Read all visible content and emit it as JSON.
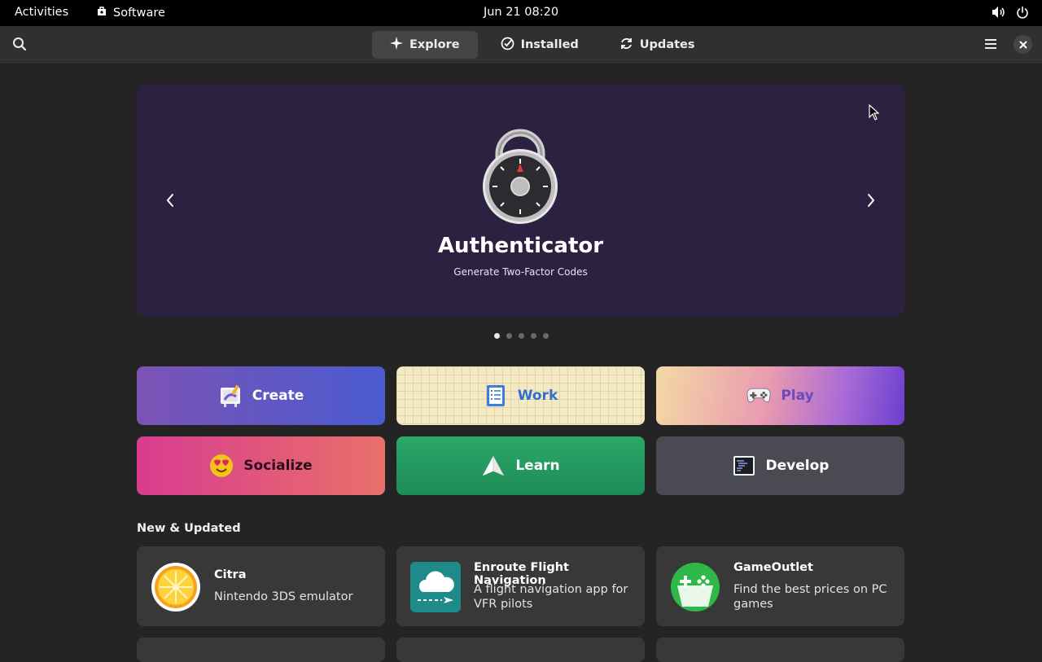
{
  "topbar": {
    "activities": "Activities",
    "app_name": "Software",
    "clock": "Jun 21  08:20",
    "icons": [
      "volume-icon",
      "power-icon"
    ]
  },
  "headerbar": {
    "tabs": [
      {
        "label": "Explore",
        "icon": "sparkle-icon",
        "active": true
      },
      {
        "label": "Installed",
        "icon": "check-circle-icon",
        "active": false
      },
      {
        "label": "Updates",
        "icon": "refresh-icon",
        "active": false
      }
    ],
    "icons": [
      "search-icon",
      "menu-icon",
      "close-icon"
    ]
  },
  "carousel": {
    "title": "Authenticator",
    "subtitle": "Generate Two-Factor Codes",
    "slide_count": 5,
    "active_slide": 1,
    "background": "#2d2142"
  },
  "categories": [
    {
      "label": "Create",
      "icon": "paint-canvas-icon"
    },
    {
      "label": "Work",
      "icon": "checklist-icon"
    },
    {
      "label": "Play",
      "icon": "gamepad-icon"
    },
    {
      "label": "Socialize",
      "icon": "heart-eyes-emoji-icon"
    },
    {
      "label": "Learn",
      "icon": "paper-plane-icon"
    },
    {
      "label": "Develop",
      "icon": "terminal-icon"
    }
  ],
  "new_updated": {
    "title": "New & Updated",
    "apps": [
      {
        "name": "Citra",
        "description": "Nintendo 3DS emulator",
        "icon": "citra-icon"
      },
      {
        "name": "Enroute Flight Navigation",
        "description": "A flight navigation app for VFR pilots",
        "icon": "enroute-icon"
      },
      {
        "name": "GameOutlet",
        "description": "Find the best prices on PC games",
        "icon": "gameoutlet-icon"
      }
    ]
  },
  "colors": {
    "window_bg": "#242424",
    "headerbar_bg": "#303030",
    "card_bg": "#383838",
    "accent_work": "#2f6fd0"
  }
}
